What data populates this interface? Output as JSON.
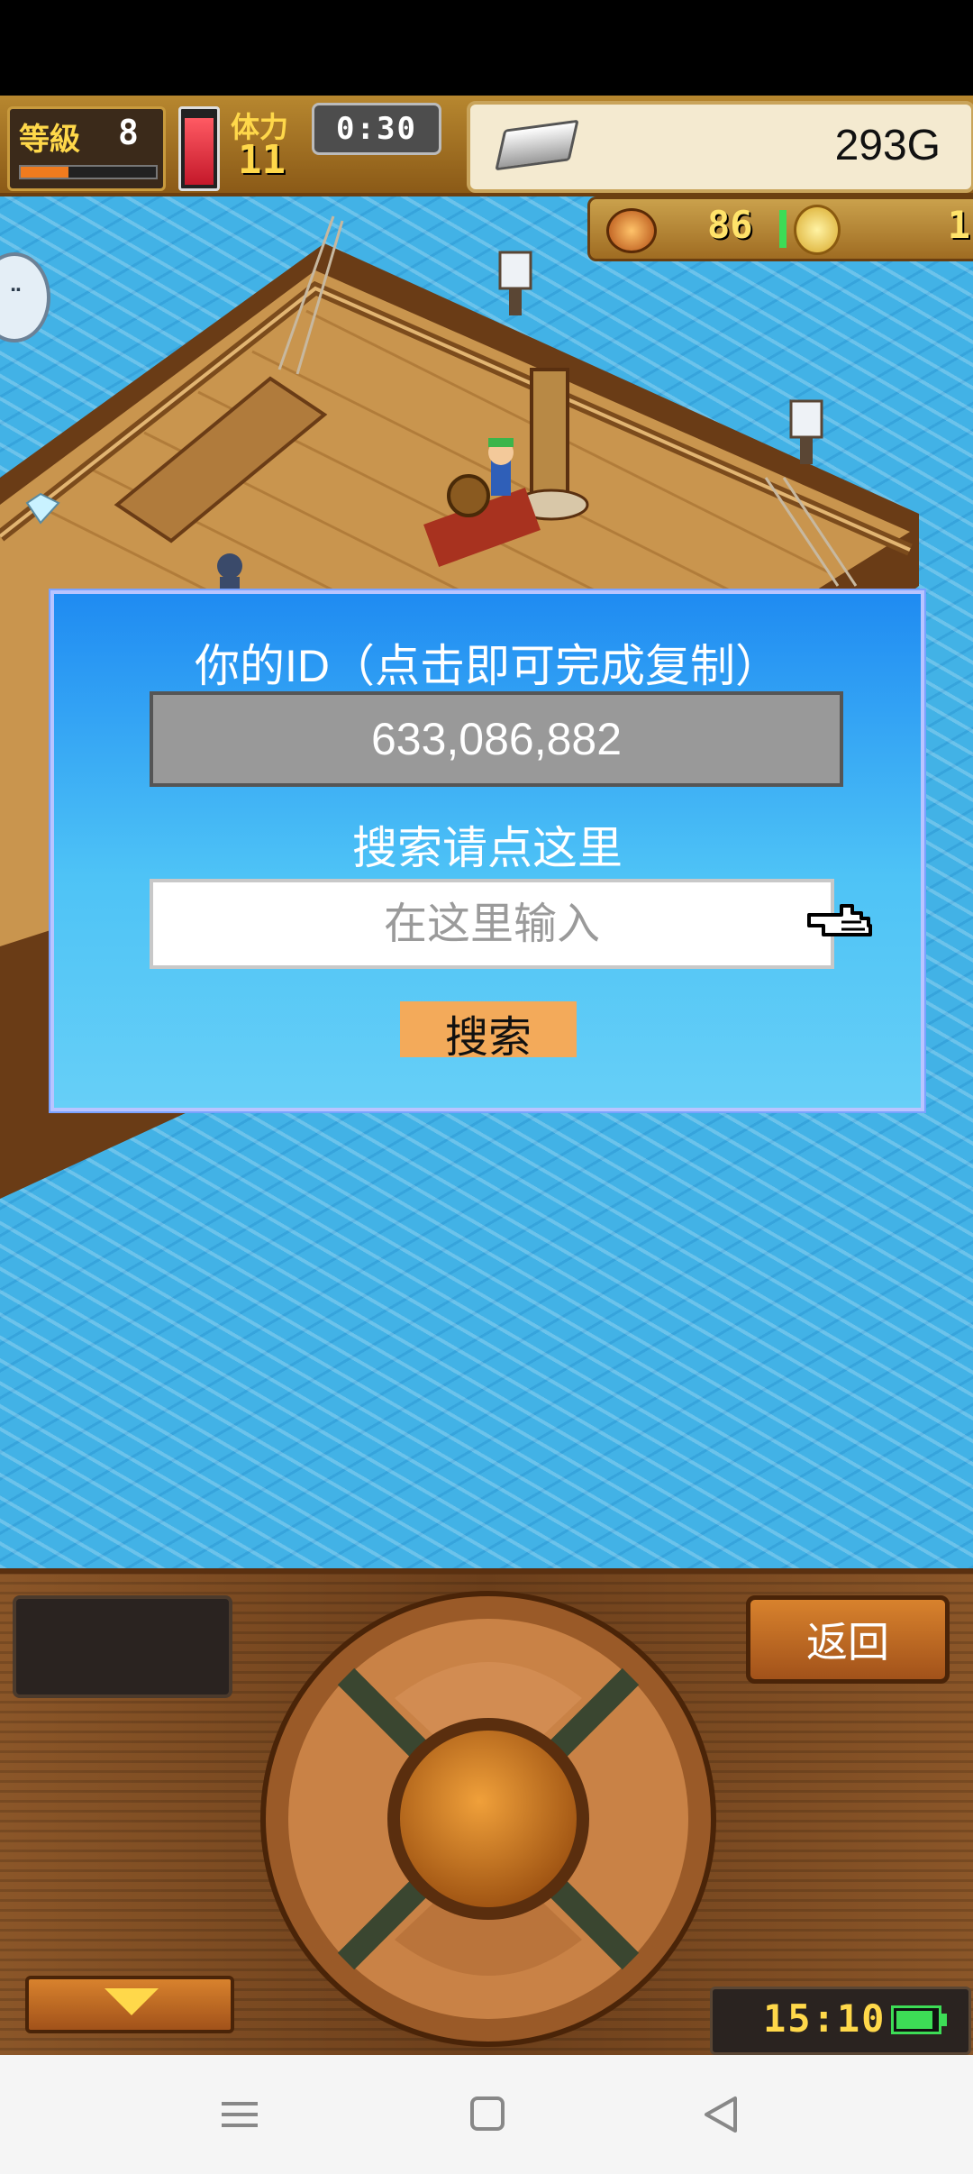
{
  "hud": {
    "level_label": "等級",
    "level_value": "8",
    "level_progress": 0.35,
    "stamina_label": "体力",
    "stamina_value": "11",
    "stamina_fill": 0.92,
    "timer": "0:30",
    "gold": "293G",
    "medal_count": "86",
    "coin_count": "1"
  },
  "dialog": {
    "id_title": "你的ID（点击即可完成复制）",
    "id_value": "633,086,882",
    "search_title": "搜索请点这里",
    "search_placeholder": "在这里输入",
    "search_value": "",
    "search_button": "搜索"
  },
  "controls": {
    "back_button": "返回",
    "clock": "15:10",
    "battery_level": 0.9
  },
  "icons": {
    "chat": "chat-bubble-icon",
    "silver": "silver-bar-icon",
    "medal": "medal-icon",
    "coin": "coin-icon",
    "pointer": "pointing-hand-icon",
    "down": "down-arrow-icon",
    "battery": "battery-icon",
    "nav": [
      "menu-icon",
      "home-square-icon",
      "back-triangle-icon"
    ]
  },
  "colors": {
    "ocean": "#42b2e6",
    "dialog_top": "#1f8bf2",
    "dialog_bottom": "#66cff7",
    "search_button": "#f3aa5a",
    "wood": "#7a4a22",
    "hud_yellow": "#ffd84a"
  }
}
